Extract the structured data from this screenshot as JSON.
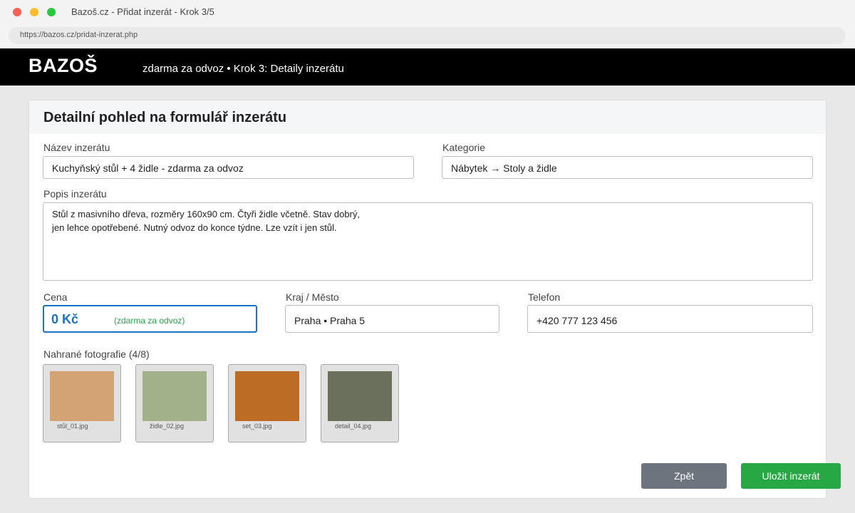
{
  "window": {
    "title": "Bazoš.cz - Přidat inzerát - Krok 3/5",
    "url": "https://bazos.cz/pridat-inzerat.php"
  },
  "header": {
    "logo": "BAZOŠ",
    "breadcrumb": "zdarma za odvoz • Krok 3: Detaily inzerátu"
  },
  "form": {
    "title": "Detailní pohled na formulář inzerátu",
    "name_label": "Název inzerátu",
    "name_value": "Kuchyňský stůl + 4 židle - zdarma za odvoz",
    "category_label": "Kategorie",
    "category_value": "Nábytek → Stoly a židle",
    "description_label": "Popis inzerátu",
    "description_line1": "Stůl z masivního dřeva, rozměry 160x90 cm. Čtyři židle včetně. Stav dobrý,",
    "description_line2": "jen lehce opotřebené. Nutný odvoz do konce týdne. Lze vzít i jen stůl.",
    "price_label": "Cena",
    "price_value": "0 Kč",
    "price_note": "(zdarma za odvoz)",
    "location_label": "Kraj / Město",
    "location_value": "Praha • Praha 5",
    "phone_label": "Telefon",
    "phone_value": "+420 777 123 456",
    "photos_label": "Nahrané fotografie (4/8)",
    "photos": [
      {
        "caption": "stůl_01.jpg",
        "color": "#d4a373"
      },
      {
        "caption": "židle_02.jpg",
        "color": "#a3b18a"
      },
      {
        "caption": "set_03.jpg",
        "color": "#bc6c25"
      },
      {
        "caption": "detail_04.jpg",
        "color": "#6b705c"
      }
    ],
    "back_label": "Zpět",
    "save_label": "Uložit inzerát"
  },
  "colors": {
    "accent": "#1a73c2",
    "success": "#28a745",
    "secondary": "#6c757d"
  }
}
